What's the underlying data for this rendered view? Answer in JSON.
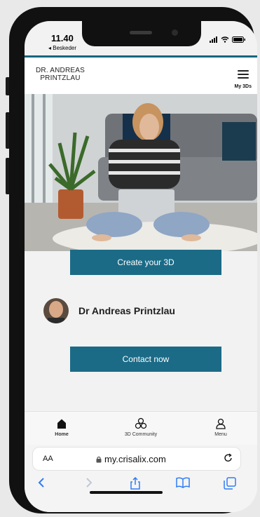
{
  "status": {
    "time": "11.40",
    "back_label": "◂ Beskeder"
  },
  "header": {
    "logo_line1": "DR. ANDREAS",
    "logo_line2": "PRINTZLAU",
    "my3d_label": "My 3Ds"
  },
  "hero": {
    "create_button": "Create your 3D"
  },
  "doctor": {
    "name": "Dr Andreas Printzlau"
  },
  "contact": {
    "button": "Contact now"
  },
  "tabbar": {
    "items": [
      {
        "label": "Home"
      },
      {
        "label": "3D Community"
      },
      {
        "label": "Menu"
      }
    ]
  },
  "safari": {
    "aa": "AA",
    "url": "my.crisalix.com"
  },
  "colors": {
    "accent": "#1b6b87",
    "teal_bar": "#16677e"
  }
}
